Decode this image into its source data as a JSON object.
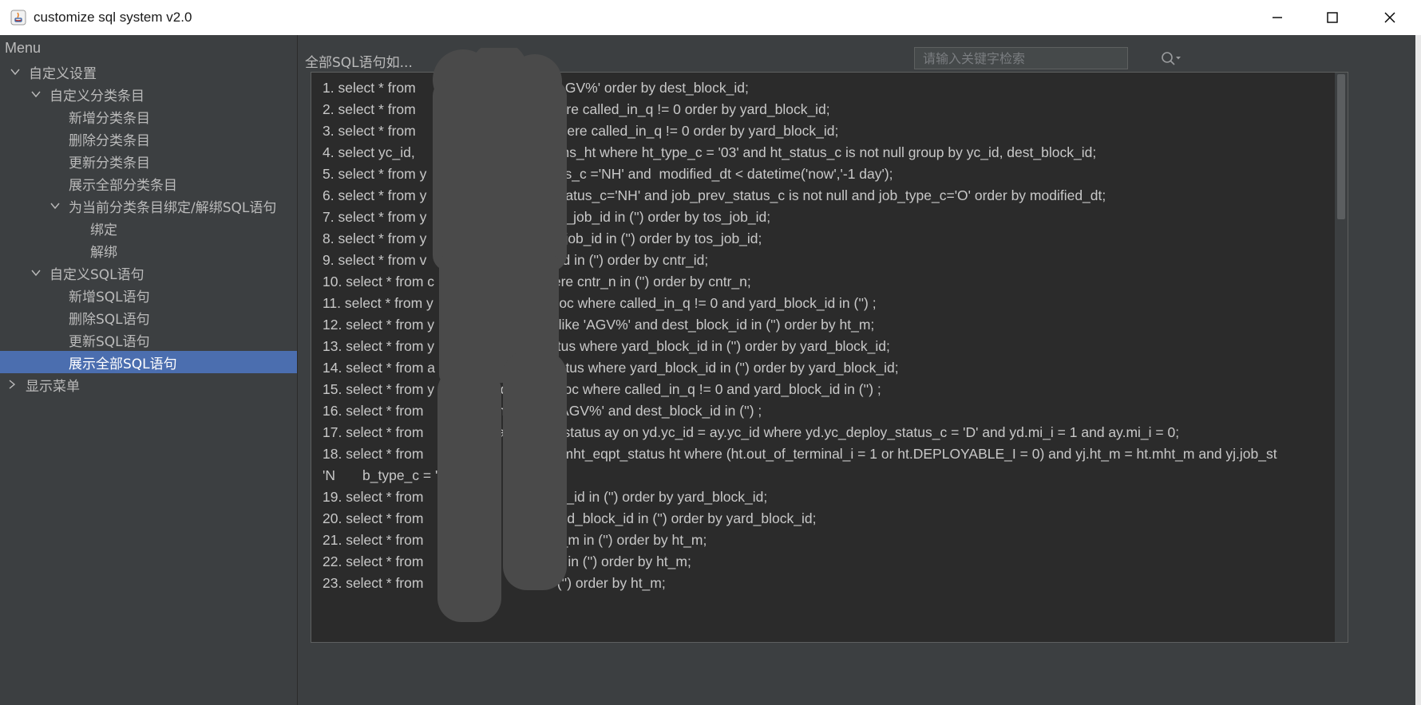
{
  "window": {
    "title": "customize sql system v2.0",
    "controls": [
      "minimize",
      "maximize",
      "close"
    ]
  },
  "sidebar": {
    "header": "Menu",
    "tree": [
      {
        "label": "自定义设置",
        "level": 0,
        "expanded": true
      },
      {
        "label": "自定义分类条目",
        "level": 1,
        "expanded": true
      },
      {
        "label": "新增分类条目",
        "level": 2
      },
      {
        "label": "删除分类条目",
        "level": 2
      },
      {
        "label": "更新分类条目",
        "level": 2
      },
      {
        "label": "展示全部分类条目",
        "level": 2
      },
      {
        "label": "为当前分类条目绑定/解绑SQL语句",
        "level": 2,
        "expanded": true
      },
      {
        "label": "绑定",
        "level": 3
      },
      {
        "label": "解绑",
        "level": 3
      },
      {
        "label": "自定义SQL语句",
        "level": 1,
        "expanded": true
      },
      {
        "label": "新增SQL语句",
        "level": 2
      },
      {
        "label": "删除SQL语句",
        "level": 2
      },
      {
        "label": "更新SQL语句",
        "level": 2
      },
      {
        "label": "展示全部SQL语句",
        "level": 2,
        "selected": true
      },
      {
        "label": "显示菜单",
        "level": 0,
        "expanded": false
      }
    ]
  },
  "main": {
    "label": "全部SQL语句如...",
    "search": {
      "placeholder": "请输入关键字检索",
      "value": ""
    },
    "sql_lines": [
      "1. select * from                    n not like 'AGV%' order by dest_block_id;",
      "2. select * from                    y_alloc where called_in_q != 0 order by yard_block_id;",
      "3. select * from                    ne_alloc where called_in_q != 0 order by yard_block_id;",
      "4. select yc_id,                    (*) from ydms_ht where ht_type_c = '03' and ht_status_c is not null group by yc_id, dest_block_id;",
      "5. select * from y                  e job_status_c ='NH' and  modified_dt < datetime('now','-1 day');",
      "6. select * from y                  here job_status_c='NH' and job_prev_status_c is not null and job_type_c='O' order by modified_dt;",
      "7. select * from y                  r where tos_job_id in ('') order by tos_job_id;",
      "8. select * from y                  where tos_job_id in ('') order by tos_job_id;",
      "9. select * from v                  here cntr_id in ('') order by cntr_id;",
      "10. select * from c                 ntory where cntr_n in ('') order by cntr_n;",
      "11. select * from y                 d_bay_alloc where called_in_q != 0 and yard_block_id in ('') ;",
      "12. select * from y                 ht_m not like 'AGV%' and dest_block_id in ('') order by ht_m;",
      "13. select * from y                 _bay_status where yard_block_id in ('') order by yard_block_id;",
      "14. select * from a                 d_bay_status where yard_block_id in ('') order by yard_block_id;",
      "15. select * from y                 d_lane_alloc where called_in_q != 0 and yard_block_id in ('') ;",
      "16. select * from                   ht_m like 'AGV%' and dest_block_id in ('') ;",
      "17. select * from                   ayecs_yc_status ay on yd.yc_id = ay.yc_id where yd.yc_deploy_status_c = 'D' and yd.mi_i = 1 and ay.mi_i = 0;",
      "18. select * from             b        j, htms_mht_eqpt_status ht where (ht.out_of_terminal_i = 1 or ht.DEPLOYABLE_I = 0) and yj.ht_m = ht.mht_m and yj.job_st                'N       b_type_c = 'M';",
      "19. select * from           c w        d_block_id in ('') order by yard_block_id;",
      "20. select * from           c_         here yard_block_id in ('') order by yard_block_id;",
      "21. select * from           b_         here ht_m in ('') order by ht_m;",
      "22. select * from             o         re ht_m in ('') order by ht_m;",
      "23. select * from           _ wh        m in ('') order by ht_m;"
    ]
  },
  "colors": {
    "background": "#3c3f41",
    "text_area": "#2b2b2b",
    "selection": "#4b6eaf",
    "text": "#bbbbbb"
  }
}
